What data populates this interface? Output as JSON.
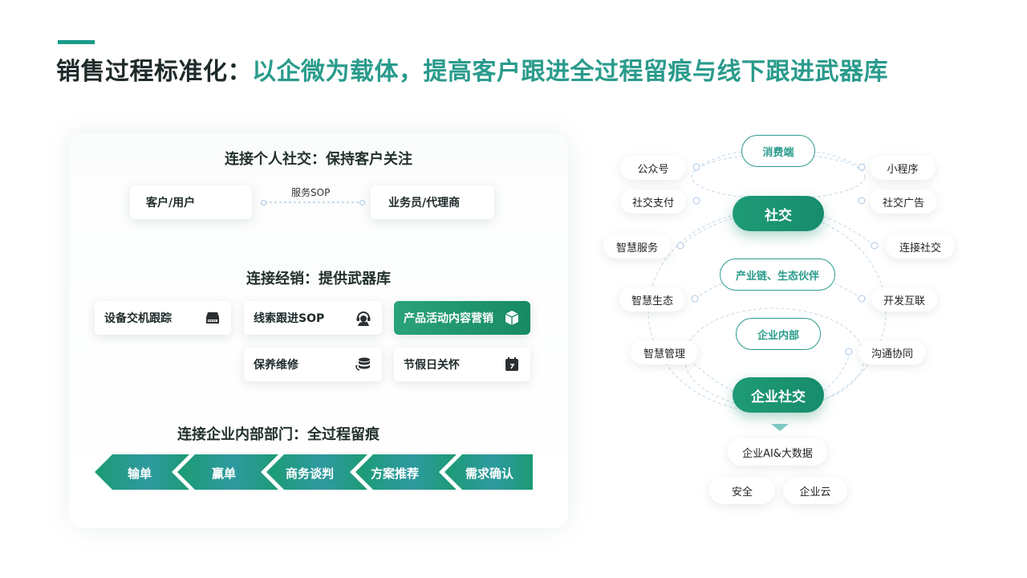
{
  "title": {
    "part1": "销售过程标准化：",
    "part2": "以企微为载体，提高客户跟进全过程留痕与线下跟进武器库"
  },
  "left": {
    "sec1": {
      "title": "连接个人社交：保持客户关注",
      "left_card": "客户/用户",
      "right_card": "业务员/代理商",
      "link_label": "服务SOP"
    },
    "sec2": {
      "title": "连接经销：提供武器库",
      "cards": [
        {
          "label": "设备交机跟踪",
          "icon": "server-icon"
        },
        {
          "label": "线索跟进SOP",
          "icon": "headset-icon"
        },
        {
          "label": "产品活动内容营销",
          "icon": "box-icon"
        },
        {
          "label": "保养维修",
          "icon": "database-sync-icon"
        },
        {
          "label": "节假日关怀",
          "icon": "calendar-icon"
        }
      ]
    },
    "sec3": {
      "title": "连接企业内部部门：全过程留痕",
      "steps": [
        "输单",
        "赢单",
        "商务谈判",
        "方案推荐",
        "需求确认"
      ]
    }
  },
  "right": {
    "top_outline": "消费端",
    "mid_outline": "产业链、生态伙伴",
    "inner_outline": "企业内部",
    "social": "社交",
    "enterprise_social": "企业社交",
    "left_items": [
      "公众号",
      "社交支付",
      "智慧服务",
      "智慧生态",
      "智慧管理"
    ],
    "right_items": [
      "小程序",
      "社交广告",
      "连接社交",
      "开发互联",
      "沟通协同"
    ],
    "bottom_items": [
      "企业AI&大数据",
      "安全",
      "企业云"
    ]
  },
  "colors": {
    "accent": "#1a9a8a",
    "title_teal": "#2a9b8c",
    "green": "#1f9b76"
  }
}
